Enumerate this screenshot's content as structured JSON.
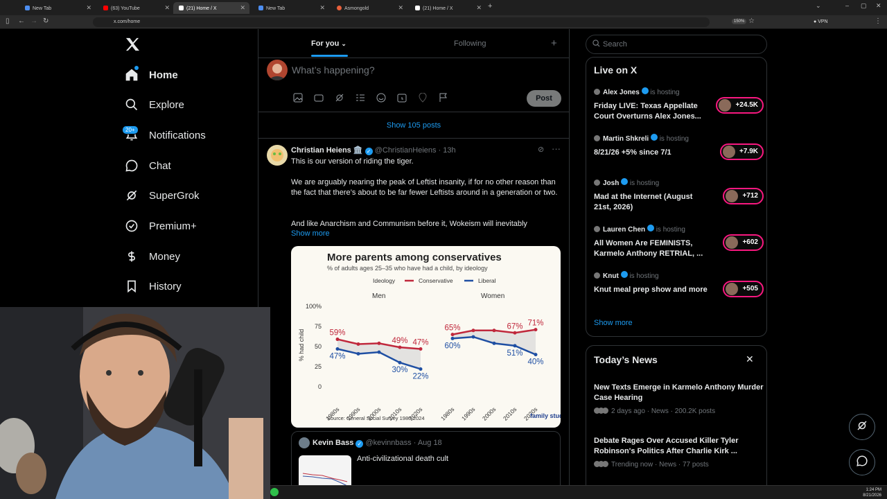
{
  "browser": {
    "tabs": [
      {
        "title": "New Tab",
        "color": "#4d8ef0"
      },
      {
        "title": "(63) YouTube",
        "color": "#ff0000"
      },
      {
        "title": "(21) Home / X",
        "color": "#ffffff"
      },
      {
        "title": "New Tab",
        "color": "#4d8ef0"
      },
      {
        "title": "Asmongold",
        "color": "#e8603c"
      },
      {
        "title": "(21) Home / X",
        "color": "#ffffff"
      }
    ],
    "url": "x.com/home",
    "zoom": "150%",
    "vpn": "VPN"
  },
  "nav": {
    "items": [
      {
        "label": "Home",
        "icon": "home-icon"
      },
      {
        "label": "Explore",
        "icon": "search-icon"
      },
      {
        "label": "Notifications",
        "icon": "bell-icon"
      },
      {
        "label": "Chat",
        "icon": "chat-icon"
      },
      {
        "label": "SuperGrok",
        "icon": "grok-icon"
      },
      {
        "label": "Premium+",
        "icon": "verified-icon"
      },
      {
        "label": "Money",
        "icon": "money-icon"
      },
      {
        "label": "History",
        "icon": "bookmark-icon"
      }
    ],
    "notifications_badge": "20+"
  },
  "feed": {
    "tab_for_you": "For you",
    "tab_following": "Following",
    "compose_placeholder": "What’s happening?",
    "post_button": "Post",
    "show_posts": "Show 105 posts"
  },
  "tweet": {
    "name": "Christian Heiens",
    "name_emoji": "🏛️",
    "handle": "@ChristianHeiens",
    "time": "· 13h",
    "lines": [
      "This is our version of riding the tiger.",
      "We are arguably nearing the peak of Leftist insanity, if for no other reason than the fact that there’s about to be far fewer Leftists around in a generation or two.",
      "And like Anarchism and Communism before it, Wokeism will inevitably"
    ],
    "show_more": "Show more"
  },
  "chart_data": {
    "type": "line",
    "title": "More parents among conservatives",
    "subtitle": "% of adults ages 25–35 who have had a child, by ideology",
    "legend_title": "Ideology",
    "ylabel": "% had child",
    "ylim": [
      0,
      100
    ],
    "yticks": [
      "0",
      "25",
      "50",
      "75",
      "100%"
    ],
    "categories": [
      "1980s",
      "1990s",
      "2000s",
      "2010s",
      "2020s"
    ],
    "series": [
      {
        "name": "Conservative",
        "color": "#c0283c"
      },
      {
        "name": "Liberal",
        "color": "#1f4fa3"
      }
    ],
    "panels": [
      {
        "title": "Men",
        "conservative": [
          59,
          53,
          54,
          49,
          47
        ],
        "liberal": [
          47,
          41,
          43,
          30,
          22
        ],
        "labels": {
          "c_first": "59%",
          "c_4": "49%",
          "c_last": "47%",
          "l_first": "47%",
          "l_4": "30%",
          "l_last": "22%"
        }
      },
      {
        "title": "Women",
        "conservative": [
          65,
          70,
          70,
          67,
          71
        ],
        "liberal": [
          60,
          62,
          54,
          51,
          40
        ],
        "labels": {
          "c_first": "65%",
          "c_4": "67%",
          "c_last": "71%",
          "l_first": "60%",
          "l_4": "51%",
          "l_last": "40%"
        }
      }
    ],
    "source": "Source: General Social Survey 1980-2024",
    "logo": "family studies"
  },
  "quote": {
    "name": "Kevin Bass",
    "handle": "@kevinnbass",
    "date": "· Aug 18",
    "text": "Anti-civilizational death cult"
  },
  "right": {
    "search_placeholder": "Search",
    "live_title": "Live on X",
    "live": [
      {
        "host": "Alex Jones",
        "status": "is hosting",
        "title": "Friday LIVE: Texas Appellate Court Overturns Alex Jones...",
        "count": "+24.5K"
      },
      {
        "host": "Martin Shkreli",
        "status": "is hosting",
        "title": "8/21/26 +5% since 7/1",
        "count": "+7.9K"
      },
      {
        "host": "Josh",
        "status": "is hosting",
        "title": "Mad at the Internet (August 21st, 2026)",
        "count": "+712"
      },
      {
        "host": "Lauren Chen",
        "status": "is hosting",
        "title": "All Women Are FEMINISTS, Karmelo Anthony RETRIAL, ...",
        "count": "+602"
      },
      {
        "host": "Knut",
        "status": "is hosting",
        "title": "Knut meal prep show and more",
        "count": "+505"
      }
    ],
    "show_more": "Show more",
    "news_title": "Today’s News",
    "news": [
      {
        "title": "New Texts Emerge in Karmelo Anthony Murder Case Hearing",
        "meta": "2 days ago · News · 200.2K posts"
      },
      {
        "title": "Debate Rages Over Accused Killer Tyler Robinson's Politics After Charlie Kirk ...",
        "meta": "Trending now · News · 77 posts"
      }
    ]
  },
  "taskbar": {
    "time": "1:24 PM",
    "date": "8/21/2026"
  }
}
